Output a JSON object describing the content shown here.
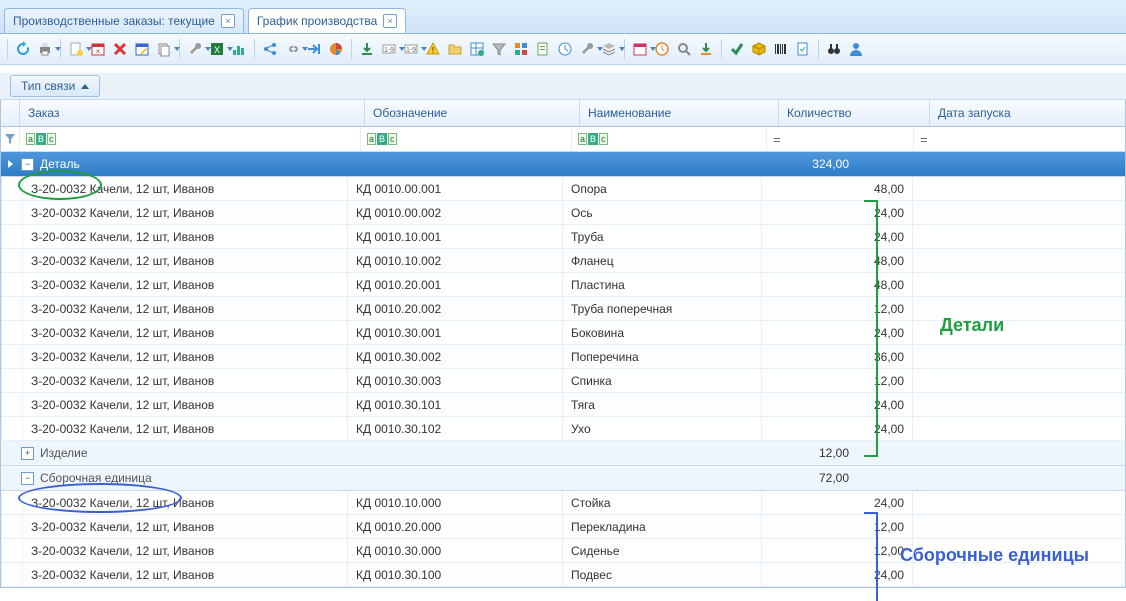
{
  "tabs": [
    {
      "label": "Производственные заказы: текущие",
      "active": false
    },
    {
      "label": "График производства",
      "active": true
    }
  ],
  "grouping": {
    "label": "Тип связи"
  },
  "columns": {
    "order": "Заказ",
    "designation": "Обозначение",
    "name": "Наименование",
    "qty": "Количество",
    "launch": "Дата запуска"
  },
  "filters": {
    "eq": "="
  },
  "groups": [
    {
      "key": "detail",
      "label": "Деталь",
      "sum": "324,00",
      "expanded": true,
      "selected": true
    },
    {
      "key": "product",
      "label": "Изделие",
      "sum": "12,00",
      "expanded": false,
      "selected": false
    },
    {
      "key": "assembly",
      "label": "Сборочная единица",
      "sum": "72,00",
      "expanded": true,
      "selected": false
    }
  ],
  "order_text": "З-20-0032 Качели, 12 шт, Иванов",
  "detail_rows": [
    {
      "d": "КД 0010.00.001",
      "n": "Опора",
      "q": "48,00"
    },
    {
      "d": "КД 0010.00.002",
      "n": "Ось",
      "q": "24,00"
    },
    {
      "d": "КД 0010.10.001",
      "n": "Труба",
      "q": "24,00"
    },
    {
      "d": "КД 0010.10.002",
      "n": "Фланец",
      "q": "48,00"
    },
    {
      "d": "КД 0010.20.001",
      "n": "Пластина",
      "q": "48,00"
    },
    {
      "d": "КД 0010.20.002",
      "n": "Труба поперечная",
      "q": "12,00"
    },
    {
      "d": "КД 0010.30.001",
      "n": "Боковина",
      "q": "24,00"
    },
    {
      "d": "КД 0010.30.002",
      "n": "Поперечина",
      "q": "36,00"
    },
    {
      "d": "КД 0010.30.003",
      "n": "Спинка",
      "q": "12,00"
    },
    {
      "d": "КД 0010.30.101",
      "n": "Тяга",
      "q": "24,00"
    },
    {
      "d": "КД 0010.30.102",
      "n": "Ухо",
      "q": "24,00"
    }
  ],
  "assembly_rows": [
    {
      "d": "КД 0010.10.000",
      "n": "Стойка",
      "q": "24,00"
    },
    {
      "d": "КД 0010.20.000",
      "n": "Перекладина",
      "q": "12,00"
    },
    {
      "d": "КД 0010.30.000",
      "n": "Сиденье",
      "q": "12,00"
    },
    {
      "d": "КД 0010.30.100",
      "n": "Подвес",
      "q": "24,00"
    }
  ],
  "annotations": {
    "details": "Детали",
    "assemblies": "Сборочные единицы"
  },
  "icons": {
    "refresh": "#2e8b57",
    "print": "#777",
    "doc": "#fff",
    "cal-red": "#c33",
    "del": "#c33",
    "cal-blue": "#36c",
    "copy": "#777",
    "wrench": "#888",
    "excel": "#1e7e34",
    "chart": "#2e8b57",
    "share": "#3a8fd6",
    "chain": "#888",
    "step": "#3a8fd6",
    "pie": "#e58a2e",
    "dl": "#2e8b57",
    "num": "#777",
    "num2": "#777",
    "warn": "#e6b800",
    "folder": "#e6c26b",
    "grid": "#3a8fd6",
    "funnel": "#888",
    "apps": "#e58a2e",
    "doc2": "#6aa84f",
    "time": "#3a8fd6",
    "wrench2": "#888",
    "layers": "#888",
    "cal": "#c36",
    "clock": "#e58a2e",
    "search": "#888",
    "dl2": "#2e8b57",
    "check": "#2e8b57",
    "box": "#e6b800",
    "barcode": "#333",
    "doc3": "#3a8fd6",
    "binoc": "#333",
    "user": "#3a8fd6"
  }
}
